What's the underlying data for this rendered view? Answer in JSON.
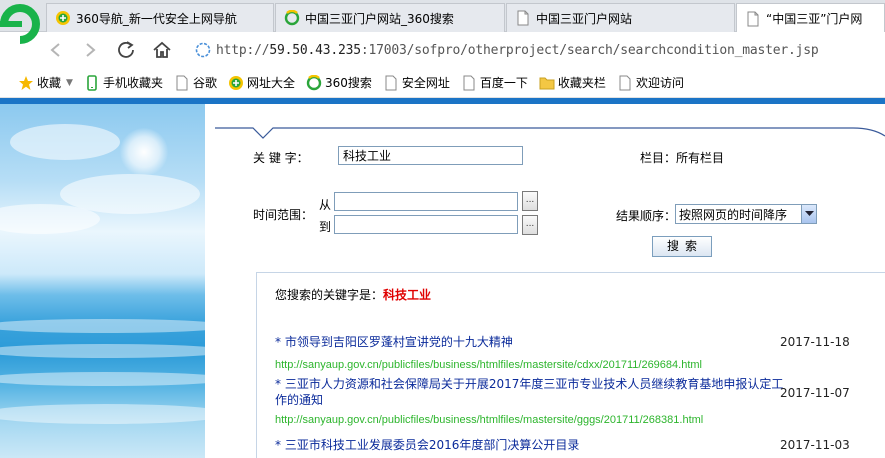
{
  "browser": {
    "tabs": [
      {
        "label": "360导航_新一代安全上网导航",
        "icon": "360-nav-icon",
        "active": false
      },
      {
        "label": "中国三亚门户网站_360搜索",
        "icon": "360-search-icon",
        "active": false
      },
      {
        "label": "中国三亚门户网站",
        "icon": "page-icon",
        "active": false
      },
      {
        "label": "“中国三亚”门户网",
        "icon": "page-icon",
        "active": true
      }
    ],
    "url_prefix": "http://",
    "url_host": "59.50.43.235",
    "url_rest": ":17003/sofpro/otherproject/search/searchcondition_master.jsp",
    "bookmarks": [
      {
        "label": "收藏",
        "icon": "star-icon",
        "dropdown": true
      },
      {
        "label": "手机收藏夹",
        "icon": "phone-icon"
      },
      {
        "label": "谷歌",
        "icon": "page-icon"
      },
      {
        "label": "网址大全",
        "icon": "360-nav-icon"
      },
      {
        "label": "360搜索",
        "icon": "360-search-icon"
      },
      {
        "label": "安全网址",
        "icon": "page-icon"
      },
      {
        "label": "百度一下",
        "icon": "page-icon"
      },
      {
        "label": "收藏夹栏",
        "icon": "folder-icon"
      },
      {
        "label": "欢迎访问",
        "icon": "page-icon"
      }
    ]
  },
  "search_form": {
    "keyword_label": "关 键 字：",
    "keyword_value": "科技工业",
    "column_label": "栏目：所有栏目",
    "time_range_label": "时间范围：",
    "from_label": "从",
    "to_label": "到",
    "from_value": "",
    "to_value": "",
    "picker_label": "...",
    "order_label": "结果顺序：",
    "order_value": "按照网页的时间降序",
    "search_button": "搜索"
  },
  "results": {
    "keyword_prefix": "您搜索的关键字是：",
    "keyword": "科技工业",
    "items": [
      {
        "title": "* 市领导到吉阳区罗蓬村宣讲党的十九大精神",
        "date": "2017-11-18",
        "url": "http://sanyaup.gov.cn/publicfiles/business/htmlfiles/mastersite/cdxx/201711/269684.html"
      },
      {
        "title": "* 三亚市人力资源和社会保障局关于开展2017年度三亚市专业技术人员继续教育基地申报认定工作的通知",
        "date": "2017-11-07",
        "url": "http://sanyaup.gov.cn/publicfiles/business/htmlfiles/mastersite/gggs/201711/268381.html"
      },
      {
        "title": "* 三亚市科技工业发展委员会2016年度部门决算公开目录",
        "date": "2017-11-03",
        "url": ""
      }
    ]
  },
  "colors": {
    "accent": "#1b74c6",
    "result_title": "#0a2a9a",
    "result_url": "#2db52d",
    "keyword_highlight": "#e00000"
  }
}
